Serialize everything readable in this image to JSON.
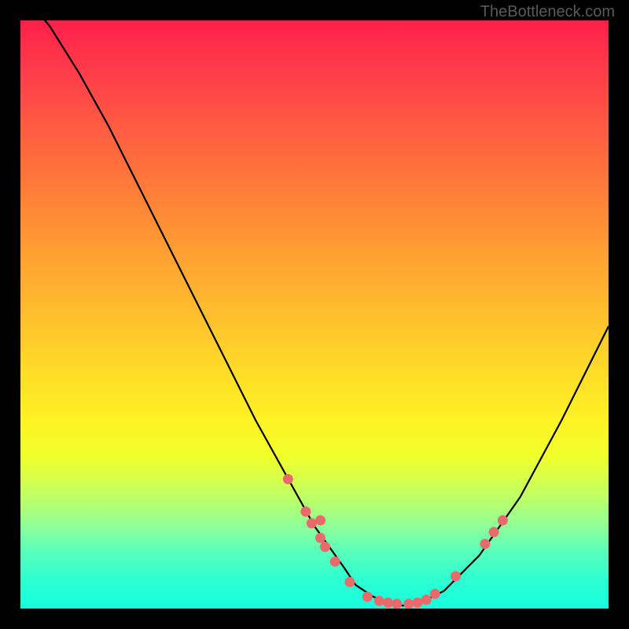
{
  "watermark": "TheBottleneck.com",
  "chart_data": {
    "type": "line",
    "title": "",
    "xlabel": "",
    "ylabel": "",
    "xlim": [
      0,
      100
    ],
    "ylim": [
      0,
      100
    ],
    "series": [
      {
        "name": "bottleneck-curve",
        "x": [
          0,
          5,
          10,
          15,
          20,
          25,
          30,
          35,
          40,
          45,
          50,
          55,
          57,
          60,
          63,
          65,
          68,
          72,
          78,
          85,
          92,
          100
        ],
        "y": [
          105,
          99,
          91,
          82,
          72,
          62,
          52,
          42,
          32,
          23,
          14,
          7,
          4,
          2,
          1,
          0.5,
          1,
          3,
          9,
          19,
          32,
          48
        ]
      }
    ],
    "markers": [
      {
        "x": 45.5,
        "y": 22
      },
      {
        "x": 48.5,
        "y": 16.5
      },
      {
        "x": 49.5,
        "y": 14.5
      },
      {
        "x": 51,
        "y": 12
      },
      {
        "x": 51,
        "y": 15
      },
      {
        "x": 51.8,
        "y": 10.5
      },
      {
        "x": 53.5,
        "y": 8
      },
      {
        "x": 56,
        "y": 4.5
      },
      {
        "x": 59,
        "y": 2
      },
      {
        "x": 61,
        "y": 1.3
      },
      {
        "x": 62.5,
        "y": 1
      },
      {
        "x": 64,
        "y": 0.8
      },
      {
        "x": 66,
        "y": 0.8
      },
      {
        "x": 67.5,
        "y": 1
      },
      {
        "x": 69,
        "y": 1.5
      },
      {
        "x": 70.5,
        "y": 2.5
      },
      {
        "x": 74,
        "y": 5.5
      },
      {
        "x": 79,
        "y": 11
      },
      {
        "x": 80.5,
        "y": 13
      },
      {
        "x": 82,
        "y": 15
      }
    ],
    "marker_color": "#e96a6a",
    "gradient_stops": [
      {
        "pos": 0,
        "color": "#ff1f4a"
      },
      {
        "pos": 50,
        "color": "#ffd728"
      },
      {
        "pos": 100,
        "color": "#14ffde"
      }
    ]
  }
}
